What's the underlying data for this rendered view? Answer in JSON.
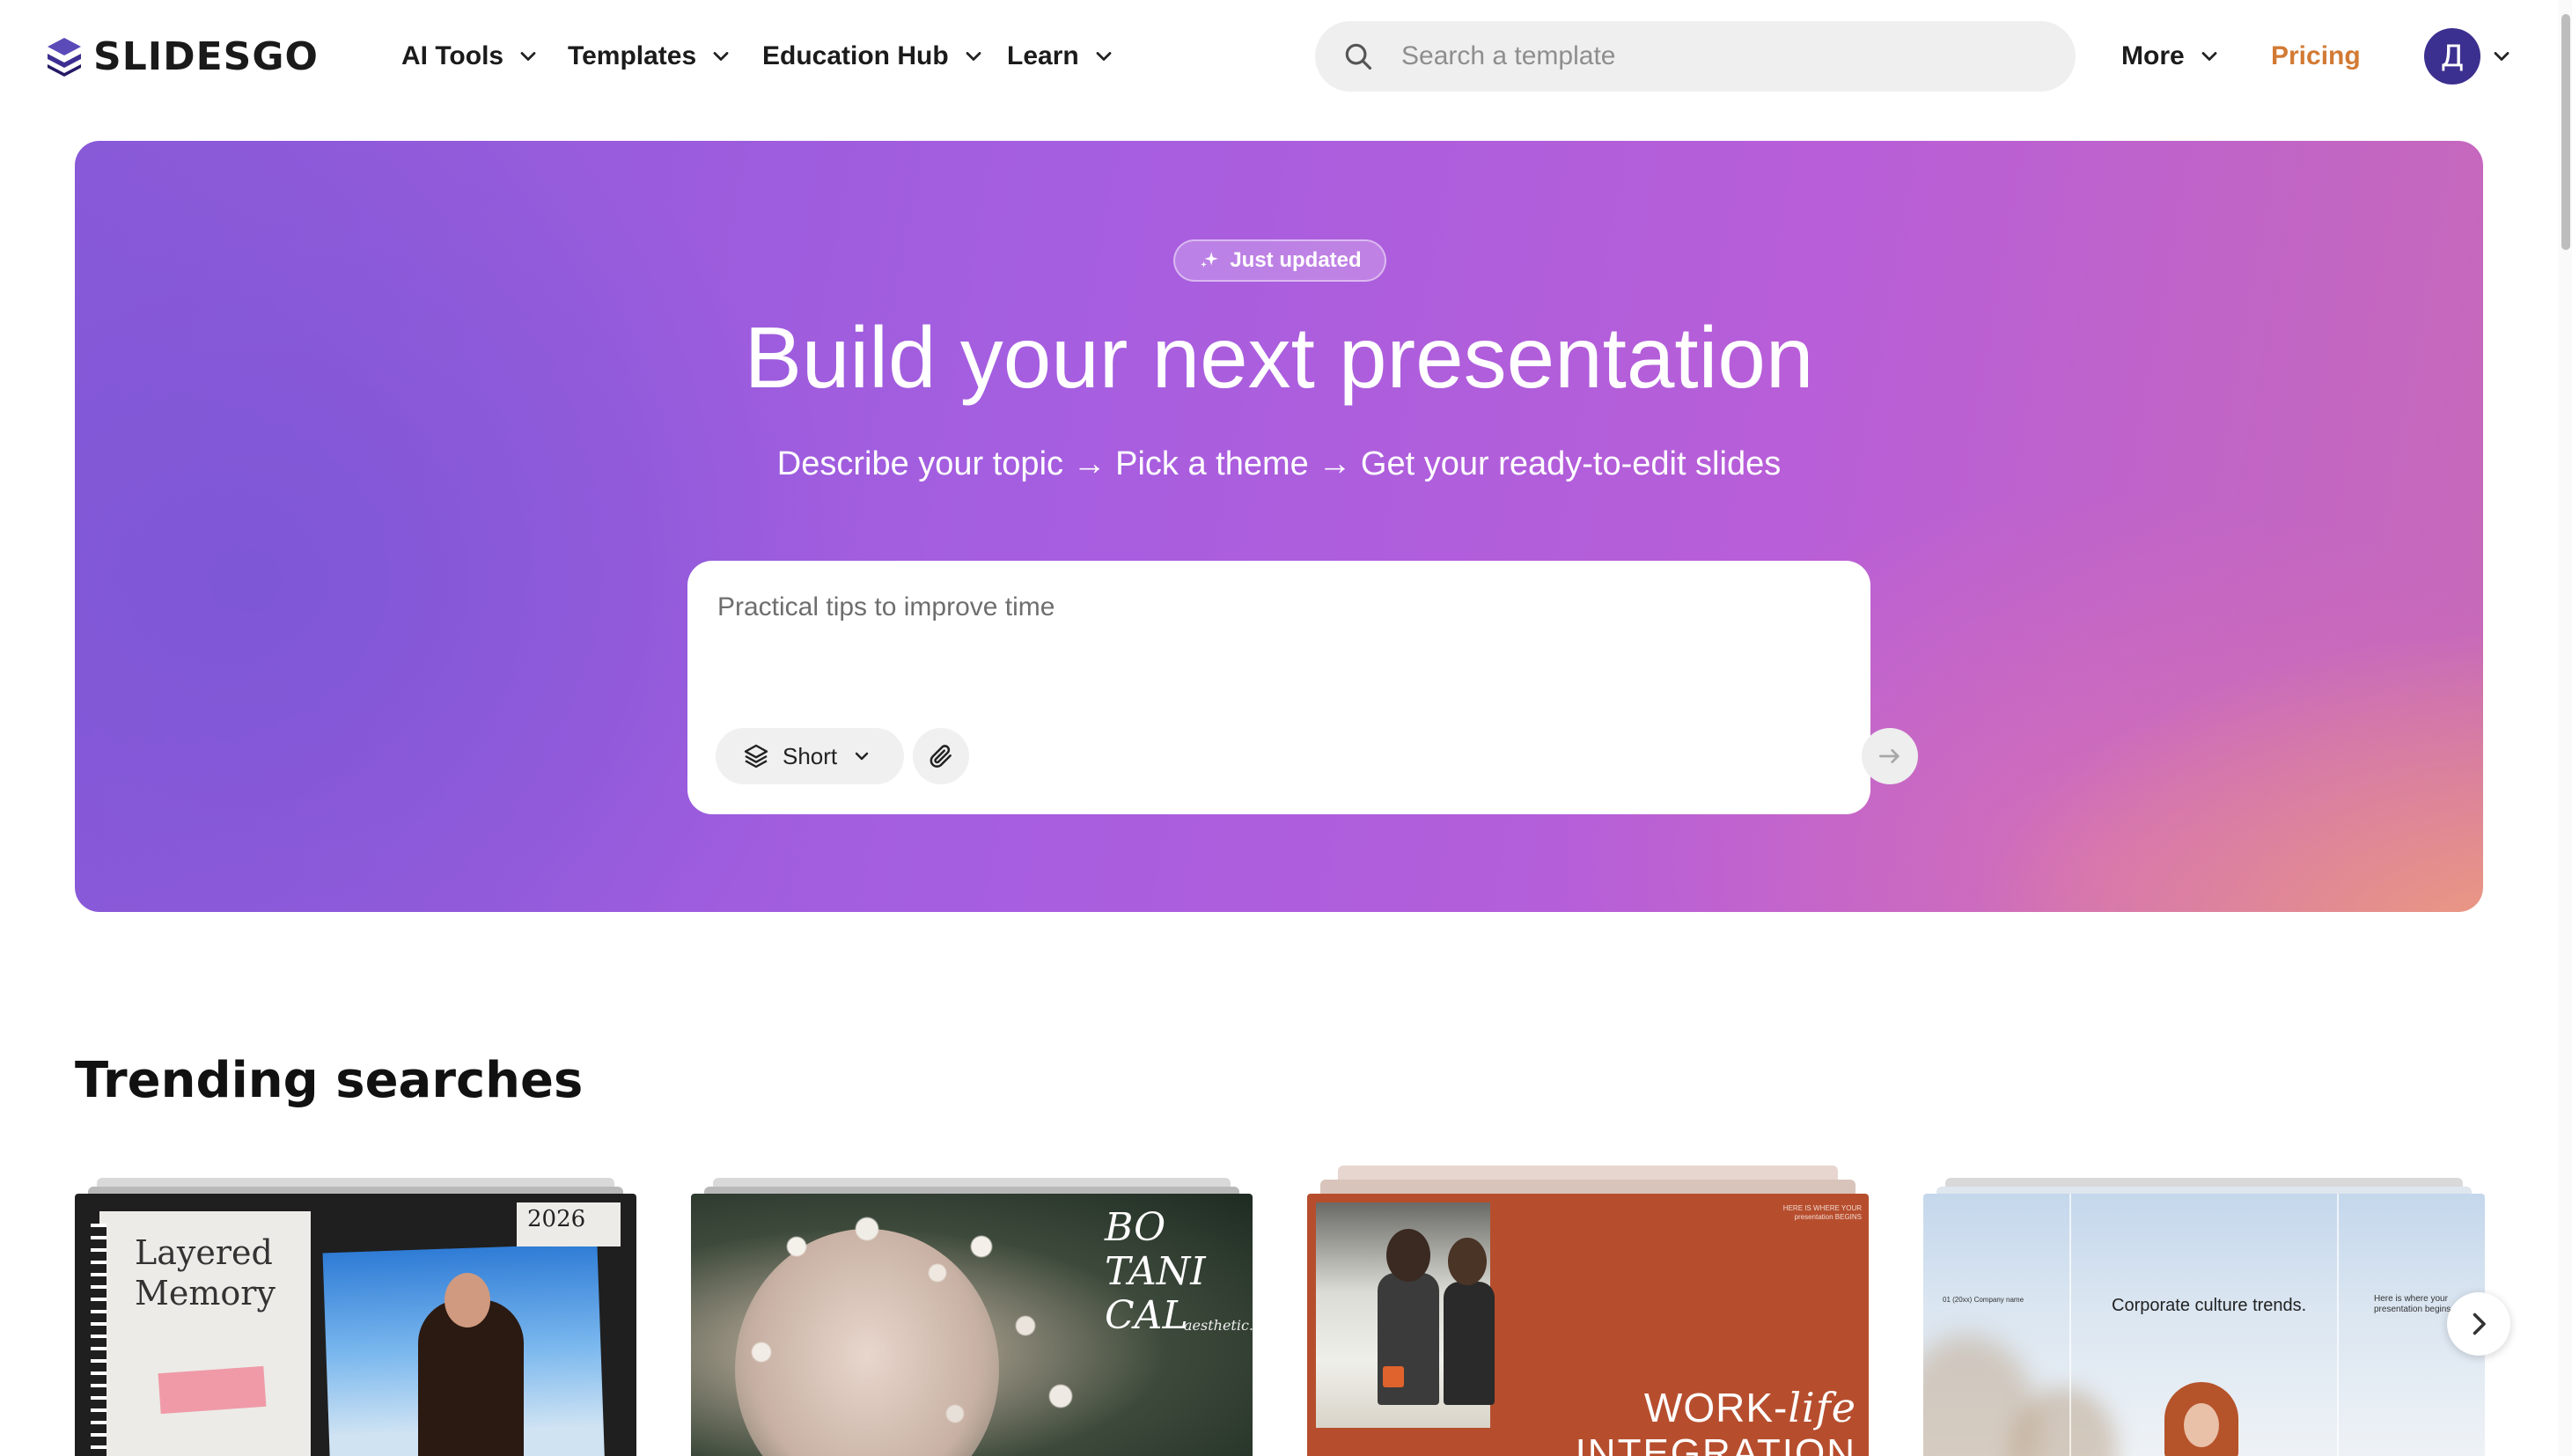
{
  "header": {
    "logo_text": "SLIDESGO",
    "nav": [
      {
        "label": "AI Tools"
      },
      {
        "label": "Templates"
      },
      {
        "label": "Education Hub"
      },
      {
        "label": "Learn"
      }
    ],
    "search_placeholder": "Search a template",
    "more_label": "More",
    "pricing_label": "Pricing",
    "avatar_initial": "Д"
  },
  "hero": {
    "badge": "Just updated",
    "title": "Build your next presentation",
    "subtitle": "Describe your topic → Pick a theme → Get your ready-to-edit slides",
    "prompt_placeholder": "Practical tips to improve time",
    "length_option": "Short"
  },
  "trending": {
    "title": "Trending searches",
    "cards": [
      {
        "title_line1": "Layered",
        "title_line2": "Memory",
        "tag": "2026"
      },
      {
        "title_line1": "BO",
        "title_line2": "TANI",
        "title_line3": "CAL",
        "note": "aesthetic."
      },
      {
        "note": "HERE IS WHERE YOUR presentation BEGINS",
        "title_line1": "WORK-",
        "title_line1_italic": "life",
        "title_line2": "INTEGRATION"
      },
      {
        "left_note": "01  (20xx) Company name",
        "center_text": "Corporate culture trends.",
        "right_note": "Here is where your presentation begins"
      }
    ]
  },
  "colors": {
    "pricing": "#d27a34",
    "avatar_bg": "#3b2f8f",
    "hero_start": "#8a5ad8",
    "hero_end": "#e8a27a"
  },
  "icons": [
    "logo-icon",
    "chevron-down-icon",
    "search-icon",
    "sparkle-icon",
    "layers-icon",
    "paperclip-icon",
    "arrow-right-icon",
    "chevron-right-icon"
  ]
}
